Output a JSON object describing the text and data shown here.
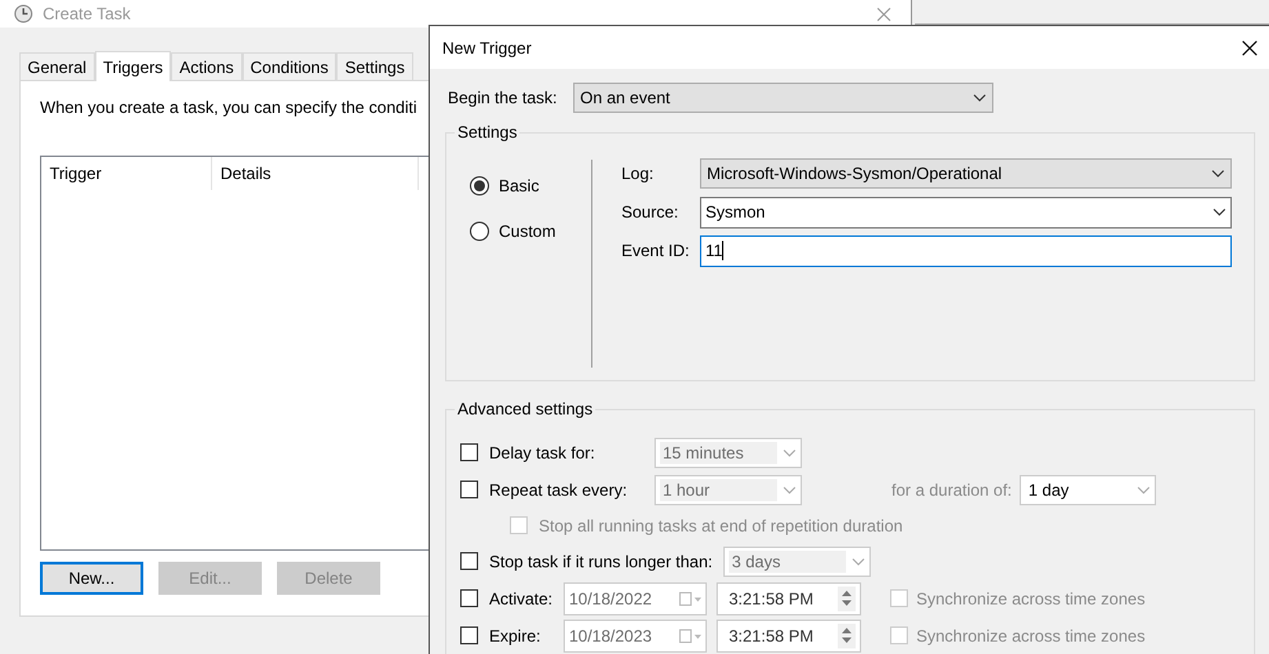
{
  "background_window": {
    "title": "Create Task",
    "tabs": [
      {
        "label": "General",
        "selected": false
      },
      {
        "label": "Triggers",
        "selected": true
      },
      {
        "label": "Actions",
        "selected": false
      },
      {
        "label": "Conditions",
        "selected": false
      },
      {
        "label": "Settings",
        "selected": false
      }
    ],
    "description": "When you create a task, you can specify the conditi",
    "table": {
      "columns": [
        "Trigger",
        "Details"
      ]
    },
    "buttons": [
      {
        "label": "New...",
        "disabled": false
      },
      {
        "label": "Edit...",
        "disabled": true
      },
      {
        "label": "Delete",
        "disabled": true
      }
    ]
  },
  "dialog": {
    "title": "New Trigger",
    "begin_the_task": {
      "label": "Begin the task:",
      "value": "On an event"
    },
    "settings": {
      "title": "Settings",
      "modes": [
        {
          "label": "Basic",
          "selected": true
        },
        {
          "label": "Custom",
          "selected": false
        }
      ],
      "fields": [
        {
          "kind": "dropdown",
          "label": "Log:",
          "value": "Microsoft-Windows-Sysmon/Operational"
        },
        {
          "kind": "combobox",
          "label": "Source:",
          "value": "Sysmon"
        },
        {
          "kind": "text",
          "label": "Event ID:",
          "value": "11"
        }
      ]
    },
    "advanced": {
      "title": "Advanced settings",
      "rows": [
        {
          "kind": "duration",
          "label": "Delay task for:",
          "checked": false,
          "value": "15 minutes"
        },
        {
          "kind": "repeat",
          "label": "Repeat task every:",
          "checked": false,
          "value": "1 hour",
          "duration_label": "for a duration of:",
          "duration_value": "1 day"
        },
        {
          "kind": "sub_option",
          "label": "Stop all running tasks at end of repetition duration",
          "checked": false
        },
        {
          "kind": "duration",
          "label": "Stop task if it runs longer than:",
          "checked": false,
          "value": "3 days"
        },
        {
          "kind": "datetime",
          "label": "Activate:",
          "checked": false,
          "date": "10/18/2022",
          "time": "3:21:58 PM",
          "sync_label": "Synchronize across time zones",
          "sync_checked": false
        },
        {
          "kind": "datetime",
          "label": "Expire:",
          "checked": false,
          "date": "10/18/2023",
          "time": "3:21:58 PM",
          "sync_label": "Synchronize across time zones",
          "sync_checked": false
        }
      ]
    }
  }
}
